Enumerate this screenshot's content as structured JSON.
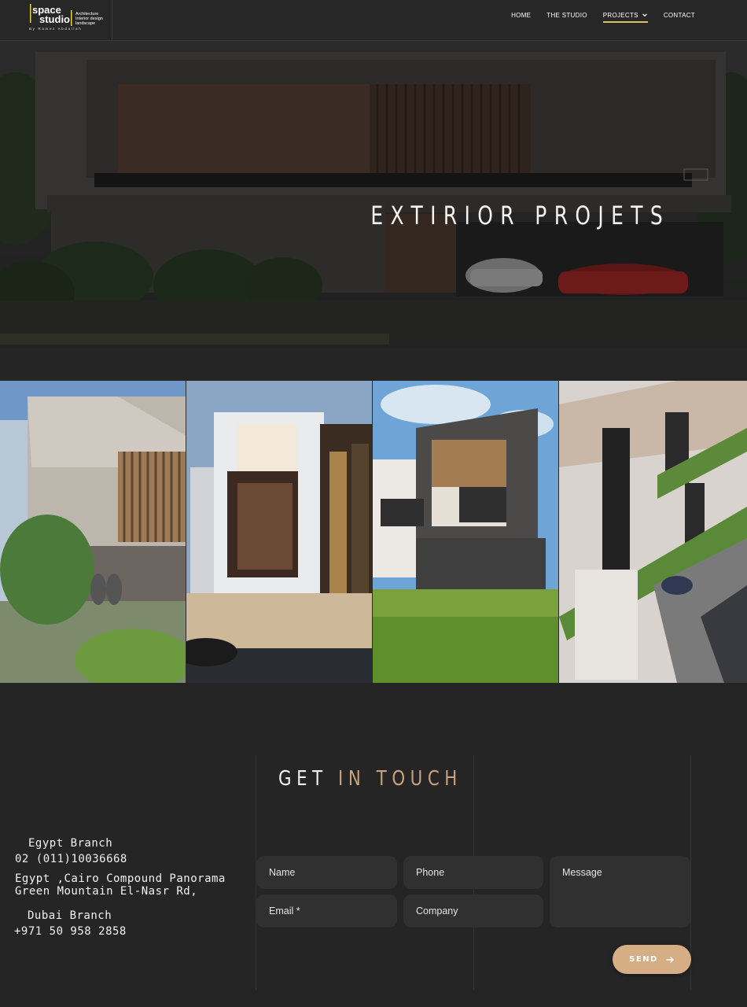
{
  "header": {
    "logo": {
      "line1": "space",
      "line2": "studio",
      "tagline1": "Architecture",
      "tagline2": "Interior design",
      "tagline3": "landscape",
      "byline": "By Ramez Abdallah"
    },
    "nav": [
      {
        "label": "HOME"
      },
      {
        "label": "THE STUDIO"
      },
      {
        "label": "PROJECTS",
        "active": true,
        "icon": "chevron-down-icon"
      },
      {
        "label": "CONTACT"
      }
    ]
  },
  "hero": {
    "title": "EXTIRIOR PROJETS"
  },
  "gallery": {
    "count": 4
  },
  "contact": {
    "title_part1": "GET",
    "title_part2": "IN TOUCH",
    "egypt_branch": "Egypt Branch",
    "egypt_phone": "02 (011)10036668",
    "egypt_address1": "Egypt ,Cairo Compound Panorama",
    "egypt_address2": "Green Mountain El-Nasr Rd,",
    "dubai_branch": "Dubai Branch",
    "dubai_phone": "+971 50 958 2858",
    "form": {
      "name": "Name",
      "phone": "Phone",
      "message": "Message",
      "email": "Email *",
      "company": "Company",
      "send": "SEND"
    }
  },
  "colors": {
    "accent_gold": "#c9a27d",
    "button": "#d6ae86",
    "nav_underline": "#d9c35a",
    "background": "#252525"
  }
}
